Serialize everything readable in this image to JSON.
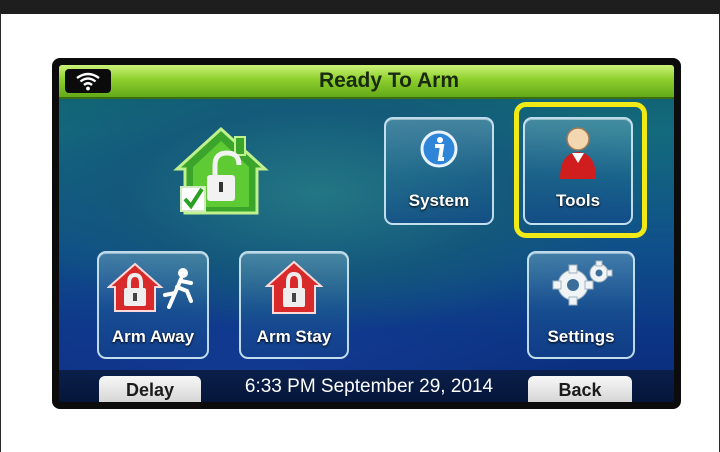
{
  "header": {
    "title": "Ready To Arm",
    "wifi_icon": "wifi-icon"
  },
  "main": {
    "status_icon": "house-unlocked-check-icon",
    "tiles": {
      "system": {
        "label": "System",
        "icon": "info-icon"
      },
      "tools": {
        "label": "Tools",
        "icon": "user-icon"
      },
      "arm_away": {
        "label": "Arm Away",
        "icon": "house-lock-running-icon"
      },
      "arm_stay": {
        "label": "Arm Stay",
        "icon": "house-lock-icon"
      },
      "settings": {
        "label": "Settings",
        "icon": "gears-icon"
      }
    },
    "highlight_color": "#f2ea16"
  },
  "footer": {
    "delay_label": "Delay",
    "datetime": "6:33 PM September 29, 2014",
    "back_label": "Back"
  },
  "colors": {
    "header_green": "#8ed02c",
    "screen_blue": "#0f4f8a",
    "house_green": "#5ecb35",
    "house_red": "#d82a2a"
  }
}
